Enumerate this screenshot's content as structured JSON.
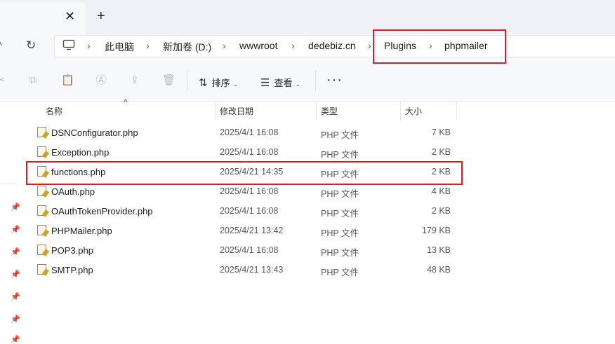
{
  "tabbar": {
    "close_glyph": "✕",
    "new_tab_glyph": "+"
  },
  "address": {
    "breadcrumbs": [
      "此电脑",
      "新加卷 (D:)",
      "wwwroot",
      "dedebiz.cn",
      "Plugins",
      "phpmailer"
    ],
    "separator": "›"
  },
  "toolbar": {
    "sort_label": "排序",
    "view_label": "查看",
    "more_glyph": "···",
    "icons": [
      "cut-icon",
      "copy-icon",
      "paste-icon",
      "rename-icon",
      "share-icon",
      "delete-icon",
      "sort-icon",
      "view-icon"
    ]
  },
  "list": {
    "columns": {
      "name": "名称",
      "date": "修改日期",
      "type": "类型",
      "size": "大小"
    },
    "rows": [
      {
        "name": "DSNConfigurator.php",
        "date": "2025/4/1 16:08",
        "type": "PHP 文件",
        "size": "7 KB"
      },
      {
        "name": "Exception.php",
        "date": "2025/4/1 16:08",
        "type": "PHP 文件",
        "size": "2 KB"
      },
      {
        "name": "functions.php",
        "date": "2025/4/21 14:35",
        "type": "PHP 文件",
        "size": "2 KB"
      },
      {
        "name": "OAuth.php",
        "date": "2025/4/1 16:08",
        "type": "PHP 文件",
        "size": "4 KB"
      },
      {
        "name": "OAuthTokenProvider.php",
        "date": "2025/4/1 16:08",
        "type": "PHP 文件",
        "size": "2 KB"
      },
      {
        "name": "PHPMailer.php",
        "date": "2025/4/21 13:42",
        "type": "PHP 文件",
        "size": "179 KB"
      },
      {
        "name": "POP3.php",
        "date": "2025/4/1 16:08",
        "type": "PHP 文件",
        "size": "13 KB"
      },
      {
        "name": "SMTP.php",
        "date": "2025/4/21 13:43",
        "type": "PHP 文件",
        "size": "48 KB"
      }
    ]
  },
  "highlight_color": "#d81e1e"
}
